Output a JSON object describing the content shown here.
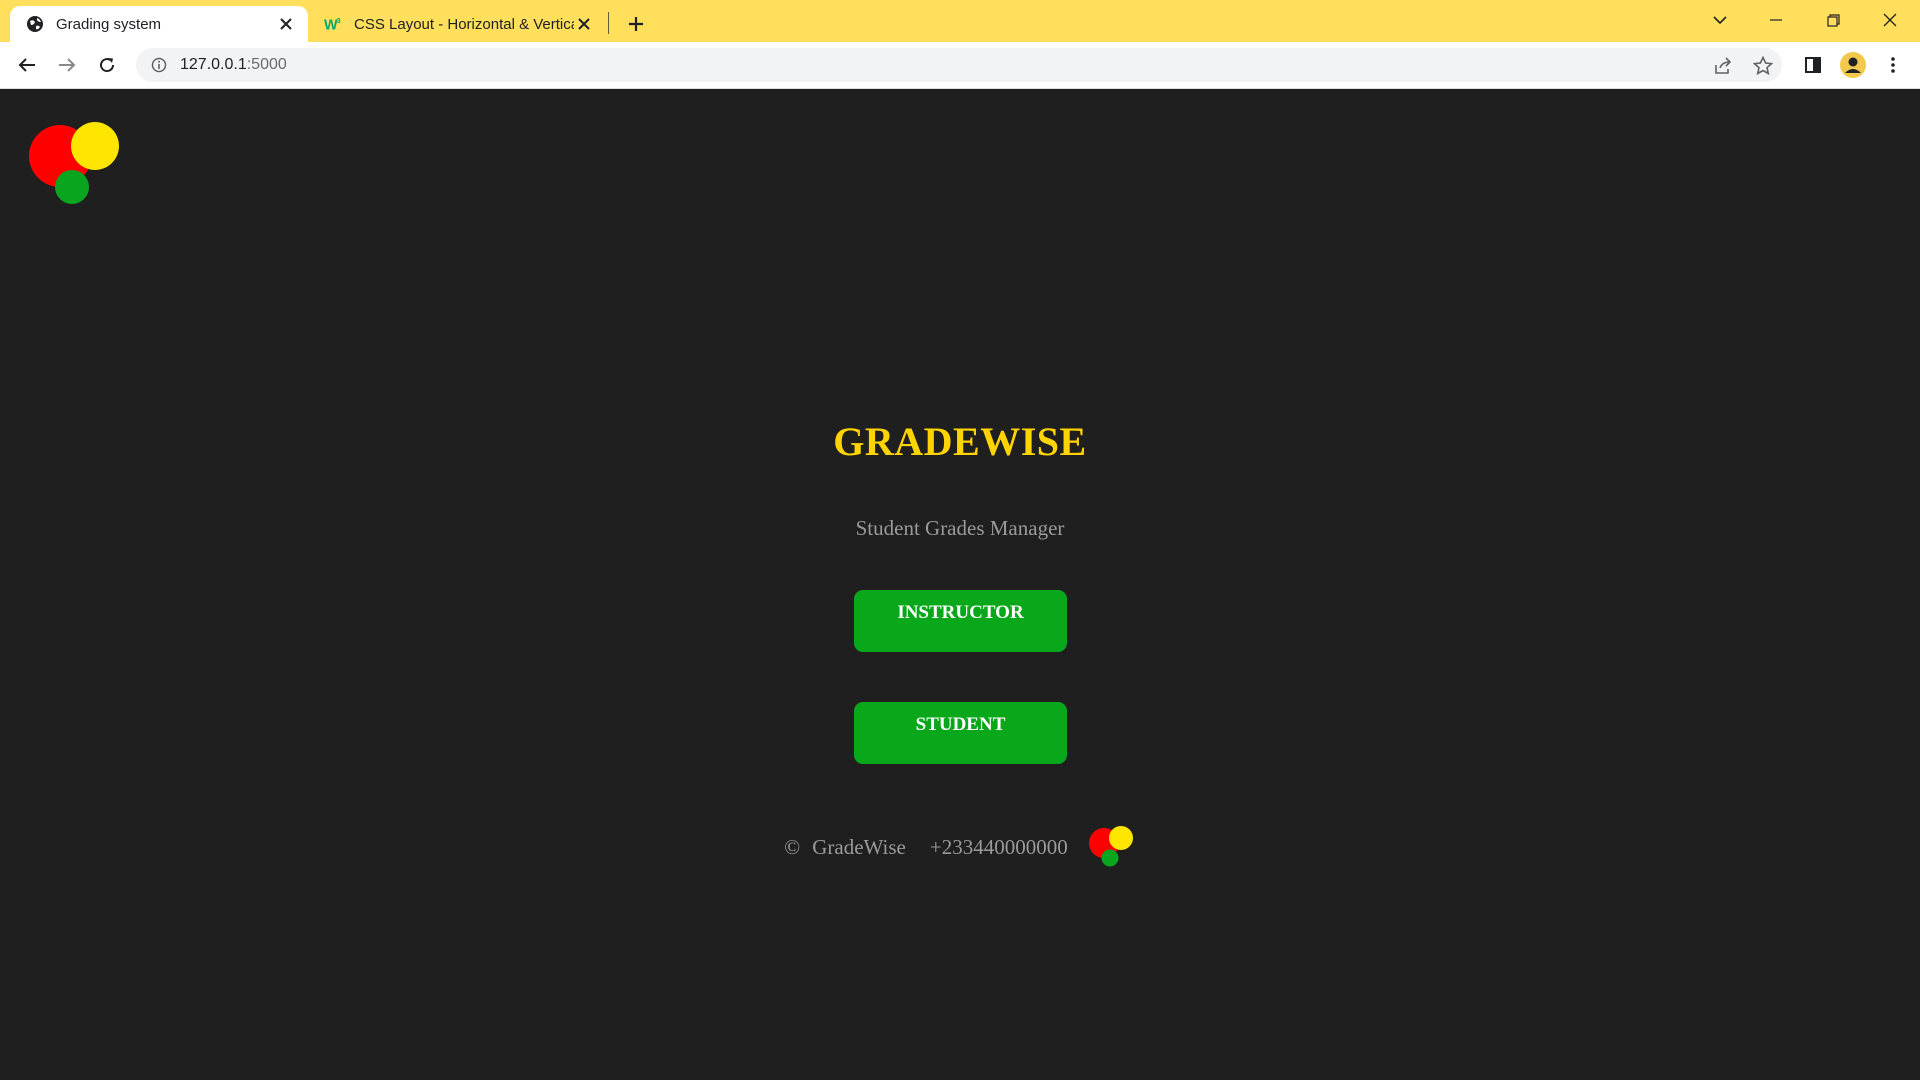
{
  "browser": {
    "tabs": [
      {
        "title": "Grading system",
        "active": true,
        "icon": "globe-icon"
      },
      {
        "title": "CSS Layout - Horizontal & Vertical Align",
        "active": false,
        "icon": "w3schools-icon"
      }
    ],
    "url": {
      "host": "127.0.0.1",
      "port": ":5000"
    }
  },
  "page": {
    "heading": "GRADEWISE",
    "subtitle": "Student Grades Manager",
    "buttons": {
      "instructor": "INSTRUCTOR",
      "student": "STUDENT"
    },
    "footer": {
      "copyright_symbol": "©",
      "brand": "GradeWise",
      "phone": "+233440000000"
    }
  },
  "colors": {
    "tabbar": "#ffdf5c",
    "page_background": "#1f1f1f",
    "heading": "#ffd400",
    "button": "#09a81b",
    "muted_text": "#9a9a9a",
    "logo_red": "#ff0000",
    "logo_yellow": "#ffe600",
    "logo_green": "#0aa51e"
  }
}
